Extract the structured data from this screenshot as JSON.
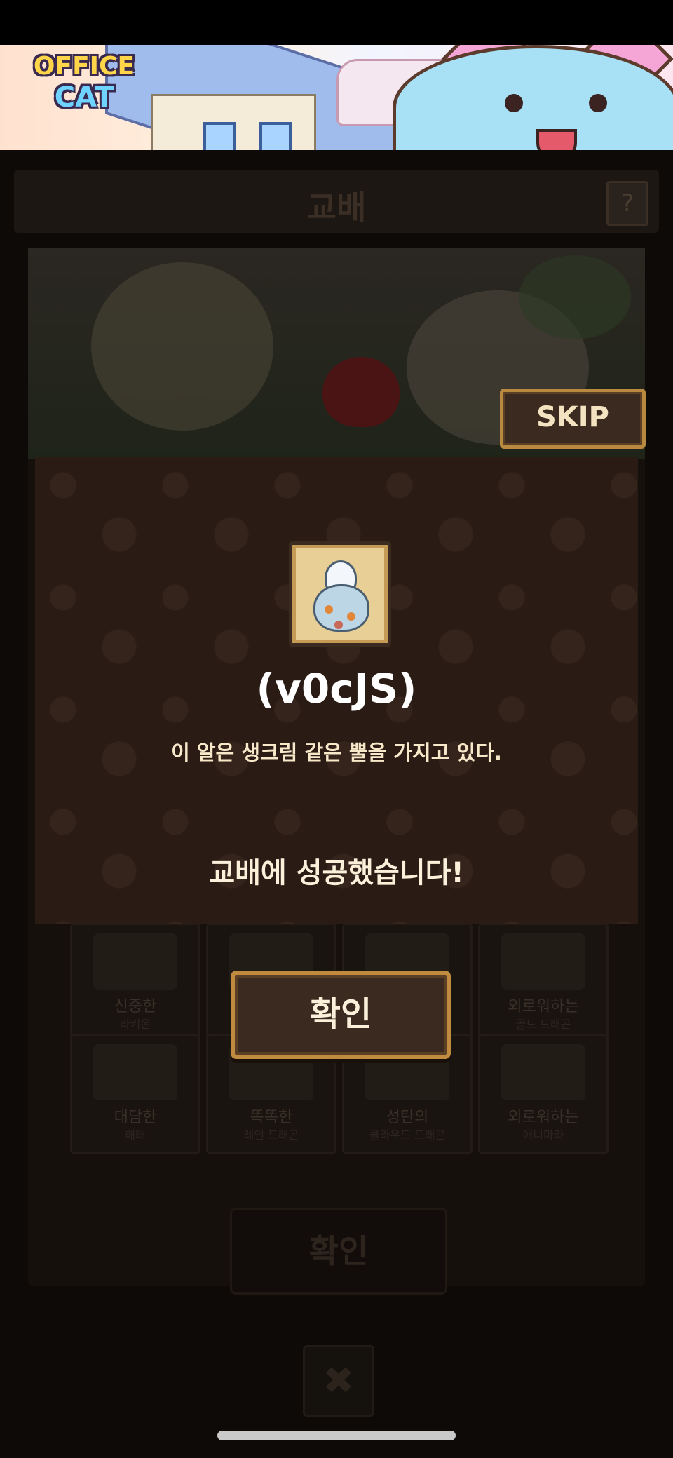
{
  "ad": {
    "logo_line1": "OFFICE",
    "logo_line2": "CAT"
  },
  "background": {
    "title": "교배",
    "help_label": "?",
    "cards": [
      {
        "name": "신중한",
        "sub": "라키온"
      },
      {
        "name": "",
        "sub": ""
      },
      {
        "name": "",
        "sub": ""
      },
      {
        "name": "외로워하는",
        "sub": "골드 드래곤"
      },
      {
        "name": "대담한",
        "sub": "해태"
      },
      {
        "name": "똑똑한",
        "sub": "레인 드래곤"
      },
      {
        "name": "성탄의",
        "sub": "클라우드 드래곤"
      },
      {
        "name": "외로워하는",
        "sub": "애니마라"
      }
    ],
    "confirm_label": "확인",
    "close_label": "✖"
  },
  "skip_label": "SKIP",
  "popup": {
    "item_name": "(v0cJS)",
    "item_description": "이 알은 생크림 같은 뿔을 가지고 있다.",
    "success_message": "교배에 성공했습니다!",
    "item_icon": "egg-icon"
  },
  "confirm_label": "확인"
}
